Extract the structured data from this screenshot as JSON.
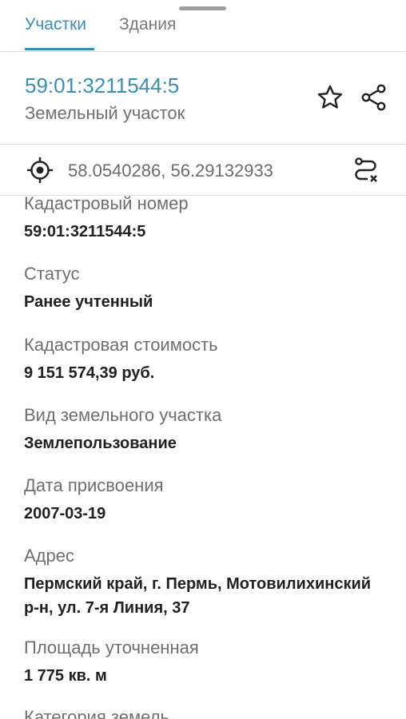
{
  "tabs": [
    {
      "label": "Участки",
      "active": true
    },
    {
      "label": "Здания",
      "active": false
    }
  ],
  "header": {
    "title": "59:01:3211544:5",
    "subtitle": "Земельный участок"
  },
  "coords": {
    "text": "58.0540286, 56.29132933"
  },
  "properties": [
    {
      "label": "Кадастровый номер",
      "value": "59:01:3211544:5"
    },
    {
      "label": "Статус",
      "value": "Ранее учтенный"
    },
    {
      "label": "Кадастровая стоимость",
      "value": "9 151 574,39 руб."
    },
    {
      "label": "Вид земельного участка",
      "value": "Землепользование"
    },
    {
      "label": "Дата присвоения",
      "value": "2007-03-19"
    },
    {
      "label": "Адрес",
      "value_lines": [
        "Пермский край, г. Пермь, Мотовилихинский",
        "р-н, ул. 7-я Линия, 37"
      ]
    },
    {
      "label": "Площадь уточненная",
      "value": "1 775 кв. м"
    },
    {
      "label": "Категория земель",
      "value": ""
    }
  ],
  "icons": {
    "favorite": "star-outline-icon",
    "share": "share-icon",
    "location": "crosshair-location-icon",
    "route": "route-cancel-icon"
  },
  "colors": {
    "accent": "#3a8fb7",
    "label": "#6f6f6f",
    "value": "#212121",
    "divider": "#dcdcdc"
  }
}
